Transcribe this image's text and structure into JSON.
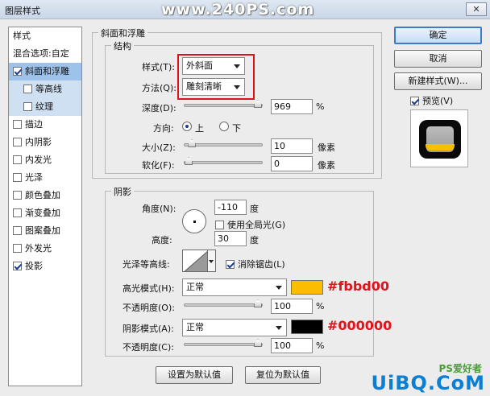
{
  "window": {
    "title": "图层样式",
    "close": "✕",
    "watermark": "www.240PS.com"
  },
  "styles_list": {
    "header": "样式",
    "blend": "混合选项:自定",
    "items": [
      {
        "label": "斜面和浮雕",
        "checked": true
      },
      {
        "label": "等高线",
        "checked": false
      },
      {
        "label": "纹理",
        "checked": false
      },
      {
        "label": "描边",
        "checked": false
      },
      {
        "label": "内阴影",
        "checked": false
      },
      {
        "label": "内发光",
        "checked": false
      },
      {
        "label": "光泽",
        "checked": false
      },
      {
        "label": "颜色叠加",
        "checked": false
      },
      {
        "label": "渐变叠加",
        "checked": false
      },
      {
        "label": "图案叠加",
        "checked": false
      },
      {
        "label": "外发光",
        "checked": false
      },
      {
        "label": "投影",
        "checked": true
      }
    ]
  },
  "bevel": {
    "title": "斜面和浮雕",
    "structure": "结构",
    "style_label": "样式(T):",
    "style_value": "外斜面",
    "technique_label": "方法(Q):",
    "technique_value": "雕刻清晰",
    "depth_label": "深度(D):",
    "depth_value": "969",
    "depth_unit": "%",
    "depth_level": 1.0,
    "direction_label": "方向:",
    "dir_up": "上",
    "dir_down": "下",
    "size_label": "大小(Z):",
    "size_value": "10",
    "size_unit": "像素",
    "size_level": 0.05,
    "soften_label": "软化(F):",
    "soften_value": "0",
    "soften_unit": "像素",
    "soften_level": 0.0
  },
  "shading": {
    "title": "阴影",
    "angle_label": "角度(N):",
    "angle_value": "-110",
    "angle_unit": "度",
    "global_light": "使用全局光(G)",
    "global_light_checked": false,
    "altitude_label": "高度:",
    "altitude_value": "30",
    "altitude_unit": "度",
    "gloss_label": "光泽等高线:",
    "anti_alias": "消除锯齿(L)",
    "anti_alias_checked": true,
    "highlight_label": "高光模式(H):",
    "highlight_mode": "正常",
    "highlight_color": "#fbbd00",
    "highlight_hex": "#fbbd00",
    "opacity1_label": "不透明度(O):",
    "opacity1_value": "100",
    "opacity1_unit": "%",
    "opacity1_level": 1.0,
    "shadow_label": "阴影模式(A):",
    "shadow_mode": "正常",
    "shadow_color": "#000000",
    "shadow_hex": "#000000",
    "opacity2_label": "不透明度(C):",
    "opacity2_value": "100",
    "opacity2_unit": "%",
    "opacity2_level": 1.0
  },
  "buttons": {
    "make_default": "设置为默认值",
    "reset_default": "复位为默认值",
    "ok": "确定",
    "cancel": "取消",
    "new_style": "新建样式(W)...",
    "preview": "预览(V)",
    "preview_checked": true
  },
  "site_logo": {
    "text": "UiBQ.CoM",
    "sub": "PS爱好者"
  }
}
